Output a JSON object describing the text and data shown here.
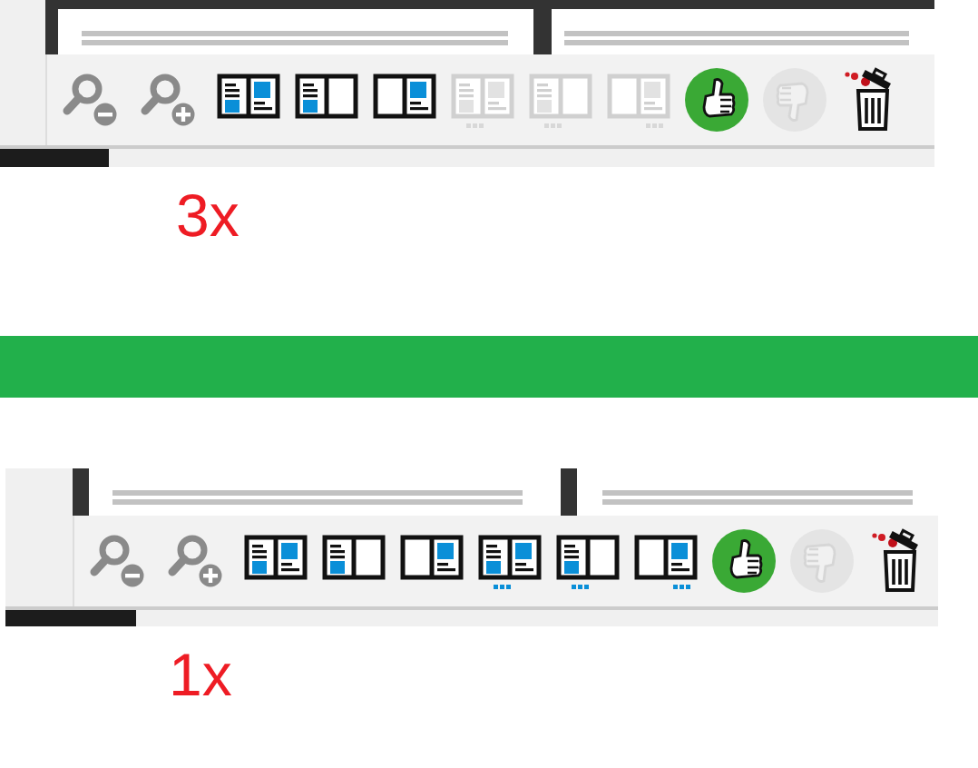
{
  "panels": [
    {
      "label": "3x",
      "tools": [
        {
          "kind": "zoom-out",
          "disabled": false
        },
        {
          "kind": "zoom-in",
          "disabled": false
        },
        {
          "kind": "layout-both",
          "disabled": false
        },
        {
          "kind": "layout-left",
          "disabled": false
        },
        {
          "kind": "layout-right",
          "disabled": false
        },
        {
          "kind": "layout-both-more",
          "disabled": true
        },
        {
          "kind": "layout-left-more",
          "disabled": true
        },
        {
          "kind": "layout-right-more",
          "disabled": true
        },
        {
          "kind": "thumbs-up",
          "disabled": false
        },
        {
          "kind": "thumbs-down",
          "disabled": true
        },
        {
          "kind": "trash",
          "disabled": false
        }
      ]
    },
    {
      "label": "1x",
      "tools": [
        {
          "kind": "zoom-out",
          "disabled": false
        },
        {
          "kind": "zoom-in",
          "disabled": false
        },
        {
          "kind": "layout-both",
          "disabled": false
        },
        {
          "kind": "layout-left",
          "disabled": false
        },
        {
          "kind": "layout-right",
          "disabled": false
        },
        {
          "kind": "layout-both-more",
          "disabled": false
        },
        {
          "kind": "layout-left-more",
          "disabled": false
        },
        {
          "kind": "layout-right-more",
          "disabled": false
        },
        {
          "kind": "thumbs-up",
          "disabled": false
        },
        {
          "kind": "thumbs-down",
          "disabled": true
        },
        {
          "kind": "trash",
          "disabled": false
        }
      ]
    }
  ]
}
